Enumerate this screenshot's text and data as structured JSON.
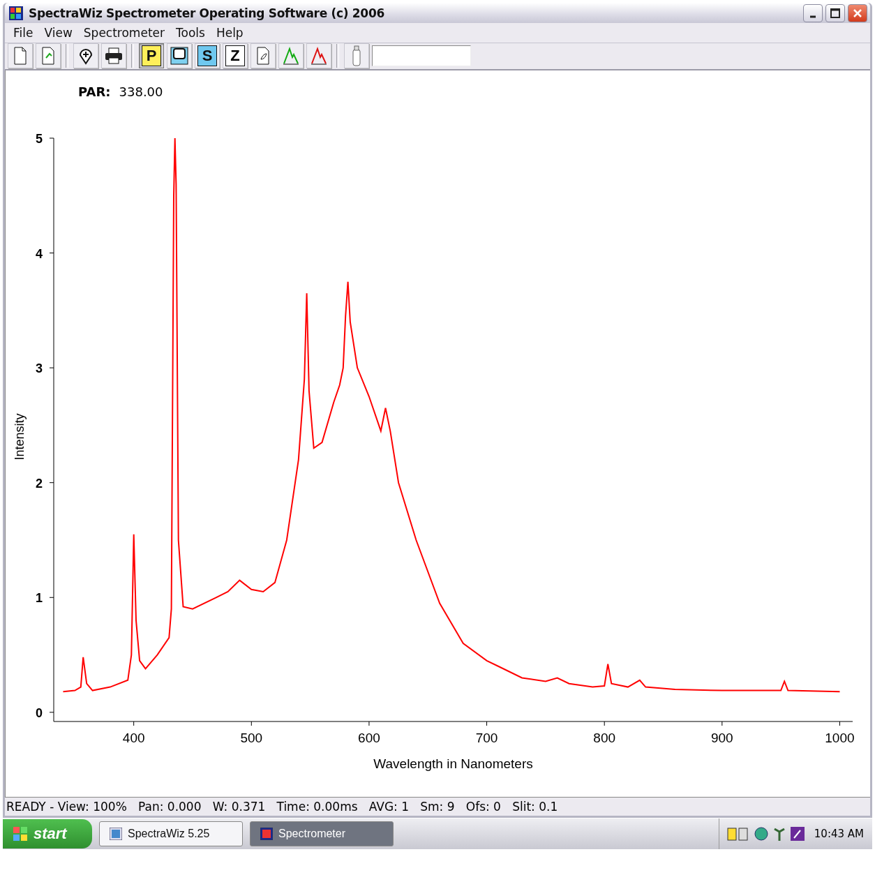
{
  "window": {
    "title": "SpectraWiz Spectrometer Operating Software (c) 2006"
  },
  "menu": [
    "File",
    "View",
    "Spectrometer",
    "Tools",
    "Help"
  ],
  "toolbar": {
    "buttons": [
      {
        "kind": "new",
        "pressed": false
      },
      {
        "kind": "open",
        "pressed": false
      },
      {
        "kind": "sep"
      },
      {
        "kind": "pin",
        "pressed": false
      },
      {
        "kind": "print",
        "pressed": false
      },
      {
        "kind": "sep"
      },
      {
        "kind": "letter",
        "glyph": "P",
        "pressed": true
      },
      {
        "kind": "scope",
        "pressed": false
      },
      {
        "kind": "letter-blue",
        "glyph": "S",
        "pressed": false
      },
      {
        "kind": "letter-dark",
        "glyph": "Z",
        "pressed": false
      },
      {
        "kind": "bottle",
        "pressed": false
      },
      {
        "kind": "peak-green",
        "pressed": false
      },
      {
        "kind": "peak-red",
        "pressed": false
      },
      {
        "kind": "sep"
      },
      {
        "kind": "vial",
        "pressed": false
      }
    ]
  },
  "plot": {
    "par_label": "PAR:",
    "par_value": "338.00",
    "chart_data": {
      "type": "line",
      "xlabel": "Wavelength in Nanometers",
      "ylabel": "Intensity",
      "xlim": [
        332,
        1011
      ],
      "ylim": [
        -0.08,
        5
      ],
      "xticks": [
        400,
        500,
        600,
        700,
        800,
        900,
        1000
      ],
      "yticks": [
        0,
        1,
        2,
        3,
        4,
        5
      ],
      "x": [
        340,
        350,
        355,
        357,
        360,
        365,
        380,
        395,
        398,
        400,
        402,
        405,
        410,
        420,
        430,
        432,
        434,
        435,
        436,
        438,
        442,
        450,
        470,
        480,
        490,
        500,
        510,
        520,
        530,
        540,
        545,
        547,
        549,
        553,
        560,
        570,
        575,
        578,
        580,
        582,
        584,
        590,
        600,
        610,
        614,
        618,
        625,
        640,
        660,
        680,
        700,
        710,
        730,
        750,
        760,
        770,
        790,
        800,
        803,
        806,
        820,
        830,
        835,
        860,
        900,
        950,
        953,
        956,
        1000
      ],
      "series": [
        {
          "color": "#ff0000",
          "values": [
            0.18,
            0.19,
            0.22,
            0.48,
            0.25,
            0.19,
            0.22,
            0.28,
            0.5,
            1.55,
            0.8,
            0.45,
            0.38,
            0.5,
            0.65,
            0.9,
            4.5,
            5.0,
            4.6,
            1.5,
            0.92,
            0.9,
            1.0,
            1.05,
            1.15,
            1.07,
            1.05,
            1.13,
            1.5,
            2.2,
            2.9,
            3.65,
            2.8,
            2.3,
            2.35,
            2.7,
            2.85,
            3.0,
            3.45,
            3.75,
            3.4,
            3.0,
            2.75,
            2.45,
            2.65,
            2.45,
            2.0,
            1.5,
            0.95,
            0.6,
            0.45,
            0.4,
            0.3,
            0.27,
            0.3,
            0.25,
            0.22,
            0.23,
            0.42,
            0.25,
            0.22,
            0.28,
            0.22,
            0.2,
            0.19,
            0.19,
            0.27,
            0.19,
            0.18
          ]
        }
      ]
    }
  },
  "status_bar": "READY - View: 100%   Pan: 0.000   W: 0.371   Time: 0.00ms   AVG: 1   Sm: 9   Ofs: 0   Slit: 0.1",
  "taskbar": {
    "start": "start",
    "tasks": [
      {
        "label": "SpectraWiz 5.25",
        "selected": false
      },
      {
        "label": "Spectrometer",
        "selected": true
      }
    ],
    "clock": "10:43 AM"
  }
}
